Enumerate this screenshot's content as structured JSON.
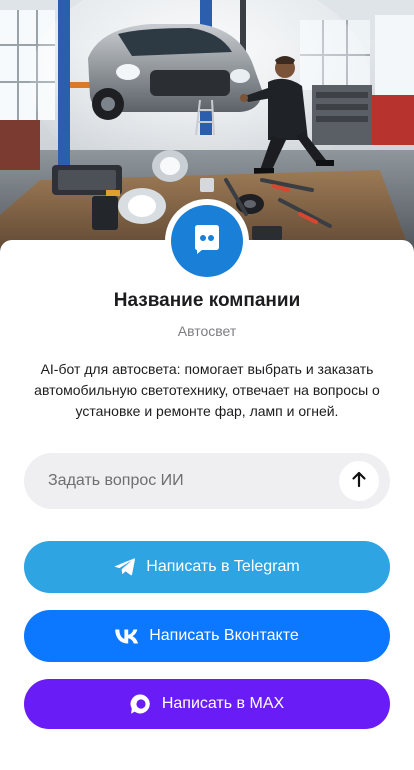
{
  "company": {
    "name": "Название компании",
    "category": "Автосвет",
    "description": "AI-бот для автосвета: помогает выбрать и заказать автомобильную светотехнику, отвечает на вопросы о установке и ремонте фар, ламп и огней.",
    "avatar_icon": "chat-bot-icon"
  },
  "ask_ai": {
    "placeholder": "Задать вопрос ИИ",
    "send_icon": "arrow-up-icon"
  },
  "buttons": {
    "telegram": {
      "label": "Написать в Telegram",
      "icon": "telegram-icon",
      "color": "#2ea4e2"
    },
    "vk": {
      "label": "Написать Вконтакте",
      "icon": "vk-icon",
      "color": "#0c77ff"
    },
    "max": {
      "label": "Написать в MAX",
      "icon": "max-icon",
      "color": "#6a1cf6"
    }
  },
  "colors": {
    "avatar": "#1a7fd6",
    "input_bg": "#efeff1"
  }
}
